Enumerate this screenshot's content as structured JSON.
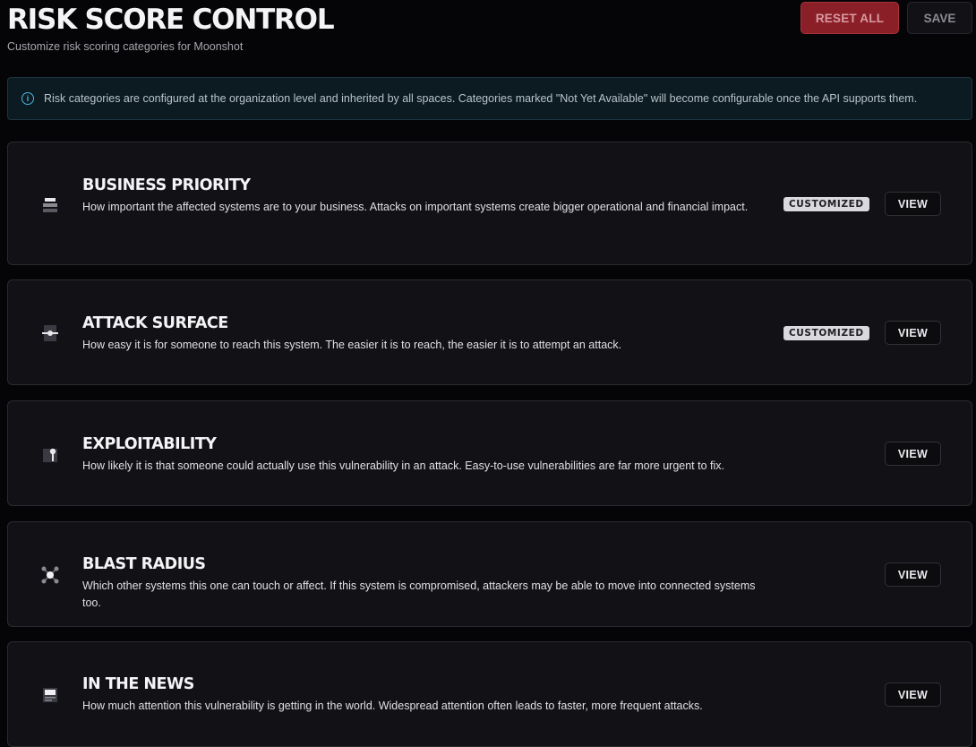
{
  "header": {
    "title": "RISK SCORE CONTROL",
    "subtitle": "Customize risk scoring categories for Moonshot",
    "reset_label": "RESET ALL",
    "save_label": "SAVE"
  },
  "notice": {
    "icon": "info-icon",
    "text": "Risk categories are configured at the organization level and inherited by all spaces. Categories marked \"Not Yet Available\" will become configurable once the API supports them."
  },
  "categories": [
    {
      "icon": "server-stack-icon",
      "title": "BUSINESS PRIORITY",
      "description": "How important the affected systems are to your business. Attacks on important systems create bigger operational and financial impact.",
      "badge": "CUSTOMIZED",
      "view_label": "VIEW"
    },
    {
      "icon": "network-node-icon",
      "title": "ATTACK SURFACE",
      "description": "How easy it is for someone to reach this system. The easier it is to reach, the easier it is to attempt an attack.",
      "badge": "CUSTOMIZED",
      "view_label": "VIEW"
    },
    {
      "icon": "exploit-pin-icon",
      "title": "EXPLOITABILITY",
      "description": "How likely it is that someone could actually use this vulnerability in an attack. Easy-to-use vulnerabilities are far more urgent to fix.",
      "badge": "",
      "view_label": "VIEW"
    },
    {
      "icon": "blast-radius-icon",
      "title": "BLAST RADIUS",
      "description": "Which other systems this one can touch or affect. If this system is compromised, attackers may be able to move into connected systems too.",
      "badge": "",
      "view_label": "VIEW"
    },
    {
      "icon": "newspaper-icon",
      "title": "IN THE NEWS",
      "description": "How much attention this vulnerability is getting in the world. Widespread attention often leads to faster, more frequent attacks.",
      "badge": "",
      "view_label": "VIEW"
    }
  ]
}
